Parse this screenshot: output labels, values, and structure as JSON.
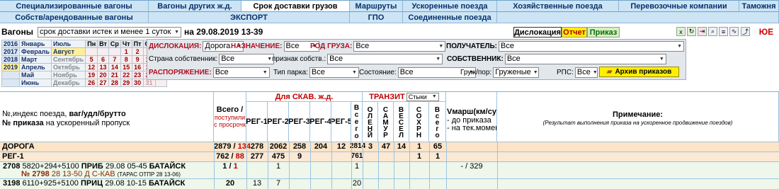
{
  "tabs_row1": [
    "Специализированные вагоны",
    "Вагоны других ж.д.",
    "Срок доставки грузов",
    "Маршруты",
    "Ускоренные поезда",
    "Хозяйственные поезда",
    "Перевозочные компании",
    "Таможня"
  ],
  "tabs_row2": [
    "Собств/арендованные вагоны",
    "ЭКСПОРТ",
    "ГПО",
    "Соединенные поезда"
  ],
  "bar": {
    "title": "Вагоны",
    "select": "срок доставки истек и менее 1 суток",
    "date": "на 29.08.2019 13-39"
  },
  "modes": {
    "dislocation": "Дислокация",
    "report": "Отчет",
    "order": "Приказ"
  },
  "calendar": {
    "years": [
      "2016",
      "2017",
      "2018",
      "2019"
    ],
    "months_left": [
      "Январь",
      "Февраль",
      "Март",
      "Апрель",
      "Май",
      "Июнь"
    ],
    "months_right": [
      "Июль",
      "Август",
      "Сентябрь",
      "Октябрь",
      "Ноябрь",
      "Декабрь"
    ],
    "daynames": [
      "Пн",
      "Вт",
      "Ср",
      "Чт",
      "Пт",
      "Сб",
      "Вс"
    ],
    "days": [
      [
        "",
        "",
        "",
        "1",
        "2",
        "3",
        "4"
      ],
      [
        "5",
        "6",
        "7",
        "8",
        "9",
        "10",
        "11"
      ],
      [
        "12",
        "13",
        "14",
        "15",
        "16",
        "17",
        "18"
      ],
      [
        "19",
        "20",
        "21",
        "22",
        "23",
        "24",
        "25"
      ],
      [
        "26",
        "27",
        "28",
        "29",
        "30",
        "31",
        ""
      ]
    ]
  },
  "filters": {
    "dislocation_label": "ДИСЛОКАЦИЯ:",
    "dislocation_value": "Дорога",
    "assignment_label": "НАЗНАЧЕНИЕ:",
    "assignment_value": "Все",
    "cargo_label": "РОД ГРУЗА:",
    "cargo_value": "Все",
    "receiver_label": "ПОЛУЧАТЕЛЬ:",
    "receiver_value": "Все",
    "owner_country_label": "Страна собственник:",
    "owner_country_value": "Все",
    "ownership_sign_label": "признак собств.:",
    "ownership_sign_value": "Все",
    "owner_label": "СОБСТВЕННИК:",
    "owner_value": "Все",
    "order_label": "РАСПОРЯЖЕНИЕ:",
    "order_value": "Все",
    "park_label": "Тип парка:",
    "park_value": "Все",
    "state_label": "Состояние:",
    "state_value": "Все",
    "load_label": "Груж/пор:",
    "load_value": "Груженые",
    "rps_label": "РПС:",
    "rps_value": "Все",
    "archive": "Архив приказов"
  },
  "table": {
    "col_train_1": "№,индекс поезда,",
    "col_train_1b": "ваг/удл/брутто",
    "col_train_2": "№ приказа",
    "col_train_2b": "на ускоренный пропуск",
    "col_total_1": "Всего /",
    "col_total_2": "поступили",
    "col_total_3": "с просрочк",
    "col_skav": "Для СКАВ. ж.д.",
    "regs": [
      "РЕГ-1",
      "РЕГ-2",
      "РЕГ-3",
      "РЕГ-4",
      "РЕГ-5"
    ],
    "vsego_v": "Всего",
    "transit_label": "ТРАНЗИТ",
    "transit_value": "Стыки",
    "transit_cols": [
      "ОЛЕНЙ",
      "САМУР",
      "ВЕСЕЛ",
      "СОХРН",
      "Всего"
    ],
    "col_vmarsh": "Vмарш(км/сут)",
    "col_vmarsh_2": "- до приказа",
    "col_vmarsh_3": "- на тек.момент",
    "col_note": "Примечание:",
    "col_note_2": "(Результат выполнения приказа на ускоренное продвижение поездов)"
  },
  "rows": {
    "road": {
      "label": "ДОРОГА",
      "total_a": "2879",
      "total_b": "134",
      "regs": [
        "278",
        "2062",
        "258",
        "204",
        "12"
      ],
      "reg_total": "2814",
      "transit": [
        "3",
        "47",
        "14",
        "1",
        "65"
      ]
    },
    "reg1": {
      "label": "РЕГ-1",
      "total_a": "762",
      "total_b": "88",
      "regs": [
        "277",
        "475",
        "9",
        "",
        ""
      ],
      "reg_total": "761",
      "transit": [
        "",
        "",
        "",
        "1",
        "1"
      ]
    },
    "train1": {
      "num": "2708",
      "info": "5820+294+5100",
      "status": "ПРИБ",
      "time": "29.08 05-45",
      "station": "БАТАЙСК",
      "order_num": "№ 2798",
      "order_info": "28 13-50 Д С-КАВ",
      "order_extra": "(ТАРАС ОТПР 28 13-06)",
      "total_a": "1",
      "total_b": "1",
      "reg2": "1",
      "reg_total": "1",
      "vmarsh": "- / 329"
    },
    "train2": {
      "num": "3198",
      "info": "6110+925+5100",
      "status": "ПРИЦ",
      "time": "29.08 10-15",
      "station": "БАТАЙСК",
      "total": "20",
      "reg1": "13",
      "reg2": "7",
      "reg_total": "20"
    }
  },
  "colors": {
    "tab_bg": "#cde4f5",
    "road_row": "#fce4c8",
    "reg_row": "#fbe9d4",
    "train_row": "#eef7ea",
    "red": "#c00000",
    "archive_btn": "#ffef00"
  }
}
